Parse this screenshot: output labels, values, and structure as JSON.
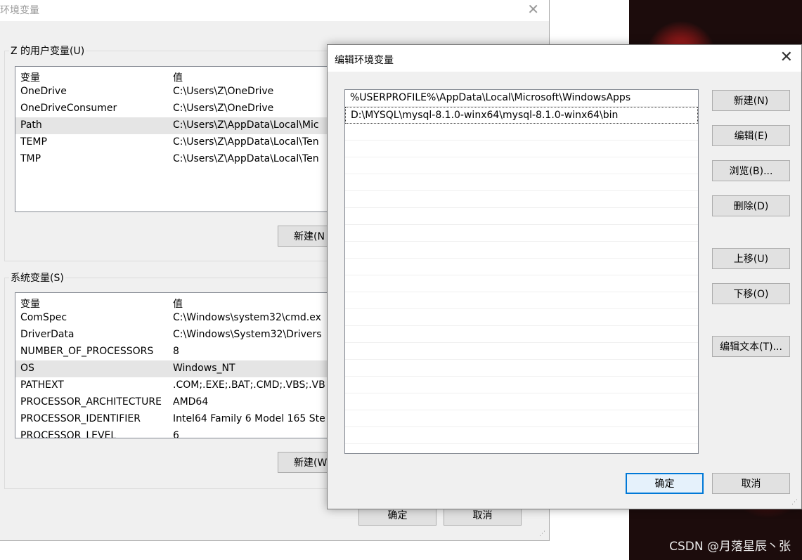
{
  "back_window": {
    "title": "环境变量",
    "user_group": {
      "legend": "Z 的用户变量(U)",
      "col_var": "变量",
      "col_val": "值",
      "rows": [
        {
          "name": "OneDrive",
          "value": "C:\\Users\\Z\\OneDrive"
        },
        {
          "name": "OneDriveConsumer",
          "value": "C:\\Users\\Z\\OneDrive"
        },
        {
          "name": "Path",
          "value": "C:\\Users\\Z\\AppData\\Local\\Mic"
        },
        {
          "name": "TEMP",
          "value": "C:\\Users\\Z\\AppData\\Local\\Ten"
        },
        {
          "name": "TMP",
          "value": "C:\\Users\\Z\\AppData\\Local\\Ten"
        }
      ],
      "new_label": "新建(N"
    },
    "system_group": {
      "legend": "系统变量(S)",
      "col_var": "变量",
      "col_val": "值",
      "rows": [
        {
          "name": "ComSpec",
          "value": "C:\\Windows\\system32\\cmd.ex"
        },
        {
          "name": "DriverData",
          "value": "C:\\Windows\\System32\\Drivers"
        },
        {
          "name": "NUMBER_OF_PROCESSORS",
          "value": "8"
        },
        {
          "name": "OS",
          "value": "Windows_NT"
        },
        {
          "name": "PATHEXT",
          "value": ".COM;.EXE;.BAT;.CMD;.VBS;.VB"
        },
        {
          "name": "PROCESSOR_ARCHITECTURE",
          "value": "AMD64"
        },
        {
          "name": "PROCESSOR_IDENTIFIER",
          "value": "Intel64 Family 6 Model 165 Ste"
        },
        {
          "name": "PROCESSOR_LEVEL",
          "value": "6"
        }
      ],
      "new_label": "新建(W"
    },
    "ok_label": "确定",
    "cancel_label": "取消"
  },
  "dialog": {
    "title": "编辑环境变量",
    "paths": [
      "%USERPROFILE%\\AppData\\Local\\Microsoft\\WindowsApps",
      "D:\\MYSQL\\mysql-8.1.0-winx64\\mysql-8.1.0-winx64\\bin"
    ],
    "buttons": {
      "new": "新建(N)",
      "edit": "编辑(E)",
      "browse": "浏览(B)...",
      "delete": "删除(D)",
      "up": "上移(U)",
      "down": "下移(O)",
      "edit_text": "编辑文本(T)..."
    },
    "ok_label": "确定",
    "cancel_label": "取消"
  },
  "watermark": "CSDN @月落星辰丶张",
  "icons": {
    "close": "close-icon",
    "grip": "resize-grip-icon"
  },
  "colors": {
    "focus_border": "#0078d7",
    "selection": "#e5e5e5",
    "button": "#e1e1e1"
  }
}
